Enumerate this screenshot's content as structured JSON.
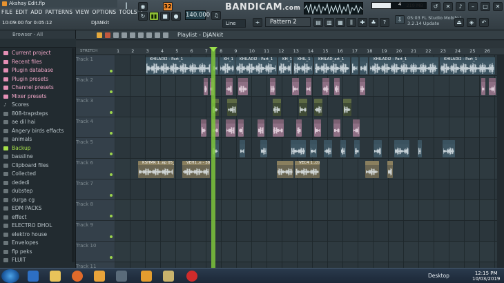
{
  "window": {
    "title": "Akshay Edit.flp",
    "brand_watermark": "BANDICAM",
    "watermark_suffix": ".com"
  },
  "menu": [
    "FILE",
    "EDIT",
    "ADD",
    "PATTERNS",
    "VIEW",
    "OPTIONS",
    "TOOLS",
    "?"
  ],
  "status": {
    "left": "10:09:00 for 0:05:12",
    "right": "DJANkit"
  },
  "transport": {
    "tempo": "140.000",
    "pattern": "Pattern 2",
    "snap": "Line",
    "song_mode_label": "SONG"
  },
  "cpu": {
    "value_label": "4",
    "memory": "219 MB",
    "fraction": 0.35
  },
  "news": {
    "line1": "05:03  FL Studio Mobile |",
    "line2": "3.2.14 Update"
  },
  "browser": {
    "header": "Browser - All",
    "items": [
      {
        "label": "Current project",
        "kind": "special"
      },
      {
        "label": "Recent files",
        "kind": "special"
      },
      {
        "label": "Plugin database",
        "kind": "special"
      },
      {
        "label": "Plugin presets",
        "kind": "special"
      },
      {
        "label": "Channel presets",
        "kind": "special"
      },
      {
        "label": "Mixer presets",
        "kind": "special"
      },
      {
        "label": "Scores",
        "kind": "note"
      },
      {
        "label": "808-trapsteps",
        "kind": "folder"
      },
      {
        "label": "ae dil hai",
        "kind": "folder"
      },
      {
        "label": "Angery birds effacts",
        "kind": "folder"
      },
      {
        "label": "animals",
        "kind": "folder"
      },
      {
        "label": "Backup",
        "kind": "selected"
      },
      {
        "label": "bassline",
        "kind": "folder"
      },
      {
        "label": "Clipboard files",
        "kind": "folder"
      },
      {
        "label": "Collected",
        "kind": "folder"
      },
      {
        "label": "dededi",
        "kind": "folder"
      },
      {
        "label": "dubstep",
        "kind": "folder"
      },
      {
        "label": "durga cg",
        "kind": "folder"
      },
      {
        "label": "EDM PACKS",
        "kind": "folder"
      },
      {
        "label": "effect",
        "kind": "folder"
      },
      {
        "label": "ELECTRO DHOL",
        "kind": "folder"
      },
      {
        "label": "elektro house",
        "kind": "folder"
      },
      {
        "label": "Envelopes",
        "kind": "folder"
      },
      {
        "label": "flp peks",
        "kind": "folder"
      },
      {
        "label": "FLUIT",
        "kind": "folder"
      }
    ]
  },
  "playlist": {
    "title": "Playlist - DjANkit",
    "timeline_label": "STRETCH",
    "bars": [
      "1",
      "2",
      "3",
      "4",
      "5",
      "6",
      "7",
      "8",
      "9",
      "10",
      "11",
      "12",
      "13",
      "14",
      "15",
      "16",
      "17",
      "18",
      "19",
      "20",
      "21",
      "22",
      "23",
      "24",
      "25",
      "26"
    ],
    "tracks": [
      {
        "name": "Track 1"
      },
      {
        "name": "Track 2"
      },
      {
        "name": "Track 3"
      },
      {
        "name": "Track 4"
      },
      {
        "name": "Track 5"
      },
      {
        "name": "Track 6"
      },
      {
        "name": "Track 7"
      },
      {
        "name": "Track 8"
      },
      {
        "name": "Track 9"
      },
      {
        "name": "Track 10"
      },
      {
        "name": "Track 11"
      }
    ],
    "clip_labels": {
      "t1a": "KHILADI2 - Part_1",
      "t1b": "KH_1",
      "t1c": "KHILADI2 - Part_1",
      "t1d": "KH_1",
      "t1e": "KHIL_1",
      "t1f": "KHILAD_art_1",
      "t1g": "KHILADI2 - Part_1",
      "t1h": "KHILADI2 - Part_1",
      "t6a": "KSHMR 1..ep 05_2",
      "t6b": "VEH1..e - 38",
      "t6c": "VEC4 1..cts 11",
      "t5a": "_ps"
    }
  },
  "taskbar": {
    "desktop": "Desktop",
    "time": "12:15 PM",
    "date": "10/03/2019"
  }
}
